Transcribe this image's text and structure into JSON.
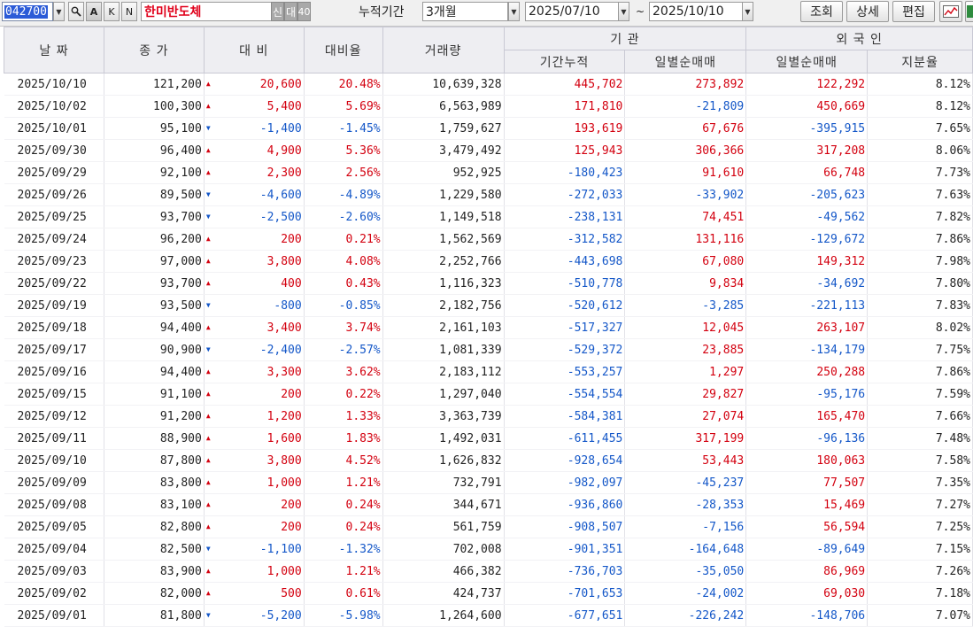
{
  "toolbar": {
    "code": "042700",
    "mode_buttons": [
      "A",
      "K",
      "N"
    ],
    "stock_name": "한미반도체",
    "tag_credit": "신",
    "tag_loan": "대",
    "tag_margin": "40",
    "period_label": "누적기간",
    "period_value": "3개월",
    "date_from": "2025/07/10",
    "date_sep": "~",
    "date_to": "2025/10/10",
    "btn_search": "조회",
    "btn_detail": "상세",
    "btn_edit": "편집"
  },
  "headers": {
    "date": "날 짜",
    "close": "종 가",
    "change": "대 비",
    "rate": "대비율",
    "volume": "거래량",
    "institution_group": "기 관",
    "inst_cumulative": "기간누적",
    "inst_daily": "일별순매매",
    "foreign_group": "외 국 인",
    "foreign_daily": "일별순매매",
    "foreign_ratio": "지분율"
  },
  "colors": {
    "up": "#d3000f",
    "down": "#1457c8",
    "neutral": "#222222",
    "header_bg": "#eeeef2"
  },
  "rows": [
    [
      "2025/10/10",
      "121,200",
      "up",
      "20,600",
      "20.48%",
      "10,639,328",
      "445,702",
      "273,892",
      "122,292",
      "8.12%"
    ],
    [
      "2025/10/02",
      "100,300",
      "up",
      "5,400",
      "5.69%",
      "6,563,989",
      "171,810",
      "-21,809",
      "450,669",
      "8.12%"
    ],
    [
      "2025/10/01",
      "95,100",
      "down",
      "-1,400",
      "-1.45%",
      "1,759,627",
      "193,619",
      "67,676",
      "-395,915",
      "7.65%"
    ],
    [
      "2025/09/30",
      "96,400",
      "up",
      "4,900",
      "5.36%",
      "3,479,492",
      "125,943",
      "306,366",
      "317,208",
      "8.06%"
    ],
    [
      "2025/09/29",
      "92,100",
      "up",
      "2,300",
      "2.56%",
      "952,925",
      "-180,423",
      "91,610",
      "66,748",
      "7.73%"
    ],
    [
      "2025/09/26",
      "89,500",
      "down",
      "-4,600",
      "-4.89%",
      "1,229,580",
      "-272,033",
      "-33,902",
      "-205,623",
      "7.63%"
    ],
    [
      "2025/09/25",
      "93,700",
      "down",
      "-2,500",
      "-2.60%",
      "1,149,518",
      "-238,131",
      "74,451",
      "-49,562",
      "7.82%"
    ],
    [
      "2025/09/24",
      "96,200",
      "up",
      "200",
      "0.21%",
      "1,562,569",
      "-312,582",
      "131,116",
      "-129,672",
      "7.86%"
    ],
    [
      "2025/09/23",
      "97,000",
      "up",
      "3,800",
      "4.08%",
      "2,252,766",
      "-443,698",
      "67,080",
      "149,312",
      "7.98%"
    ],
    [
      "2025/09/22",
      "93,700",
      "up",
      "400",
      "0.43%",
      "1,116,323",
      "-510,778",
      "9,834",
      "-34,692",
      "7.80%"
    ],
    [
      "2025/09/19",
      "93,500",
      "down",
      "-800",
      "-0.85%",
      "2,182,756",
      "-520,612",
      "-3,285",
      "-221,113",
      "7.83%"
    ],
    [
      "2025/09/18",
      "94,400",
      "up",
      "3,400",
      "3.74%",
      "2,161,103",
      "-517,327",
      "12,045",
      "263,107",
      "8.02%"
    ],
    [
      "2025/09/17",
      "90,900",
      "down",
      "-2,400",
      "-2.57%",
      "1,081,339",
      "-529,372",
      "23,885",
      "-134,179",
      "7.75%"
    ],
    [
      "2025/09/16",
      "94,400",
      "up",
      "3,300",
      "3.62%",
      "2,183,112",
      "-553,257",
      "1,297",
      "250,288",
      "7.86%"
    ],
    [
      "2025/09/15",
      "91,100",
      "up",
      "200",
      "0.22%",
      "1,297,040",
      "-554,554",
      "29,827",
      "-95,176",
      "7.59%"
    ],
    [
      "2025/09/12",
      "91,200",
      "up",
      "1,200",
      "1.33%",
      "3,363,739",
      "-584,381",
      "27,074",
      "165,470",
      "7.66%"
    ],
    [
      "2025/09/11",
      "88,900",
      "up",
      "1,600",
      "1.83%",
      "1,492,031",
      "-611,455",
      "317,199",
      "-96,136",
      "7.48%"
    ],
    [
      "2025/09/10",
      "87,800",
      "up",
      "3,800",
      "4.52%",
      "1,626,832",
      "-928,654",
      "53,443",
      "180,063",
      "7.58%"
    ],
    [
      "2025/09/09",
      "83,800",
      "up",
      "1,000",
      "1.21%",
      "732,791",
      "-982,097",
      "-45,237",
      "77,507",
      "7.35%"
    ],
    [
      "2025/09/08",
      "83,100",
      "up",
      "200",
      "0.24%",
      "344,671",
      "-936,860",
      "-28,353",
      "15,469",
      "7.27%"
    ],
    [
      "2025/09/05",
      "82,800",
      "up",
      "200",
      "0.24%",
      "561,759",
      "-908,507",
      "-7,156",
      "56,594",
      "7.25%"
    ],
    [
      "2025/09/04",
      "82,500",
      "down",
      "-1,100",
      "-1.32%",
      "702,008",
      "-901,351",
      "-164,648",
      "-89,649",
      "7.15%"
    ],
    [
      "2025/09/03",
      "83,900",
      "up",
      "1,000",
      "1.21%",
      "466,382",
      "-736,703",
      "-35,050",
      "86,969",
      "7.26%"
    ],
    [
      "2025/09/02",
      "82,000",
      "up",
      "500",
      "0.61%",
      "424,737",
      "-701,653",
      "-24,002",
      "69,030",
      "7.18%"
    ],
    [
      "2025/09/01",
      "81,800",
      "down",
      "-5,200",
      "-5.98%",
      "1,264,600",
      "-677,651",
      "-226,242",
      "-148,706",
      "7.07%"
    ]
  ]
}
